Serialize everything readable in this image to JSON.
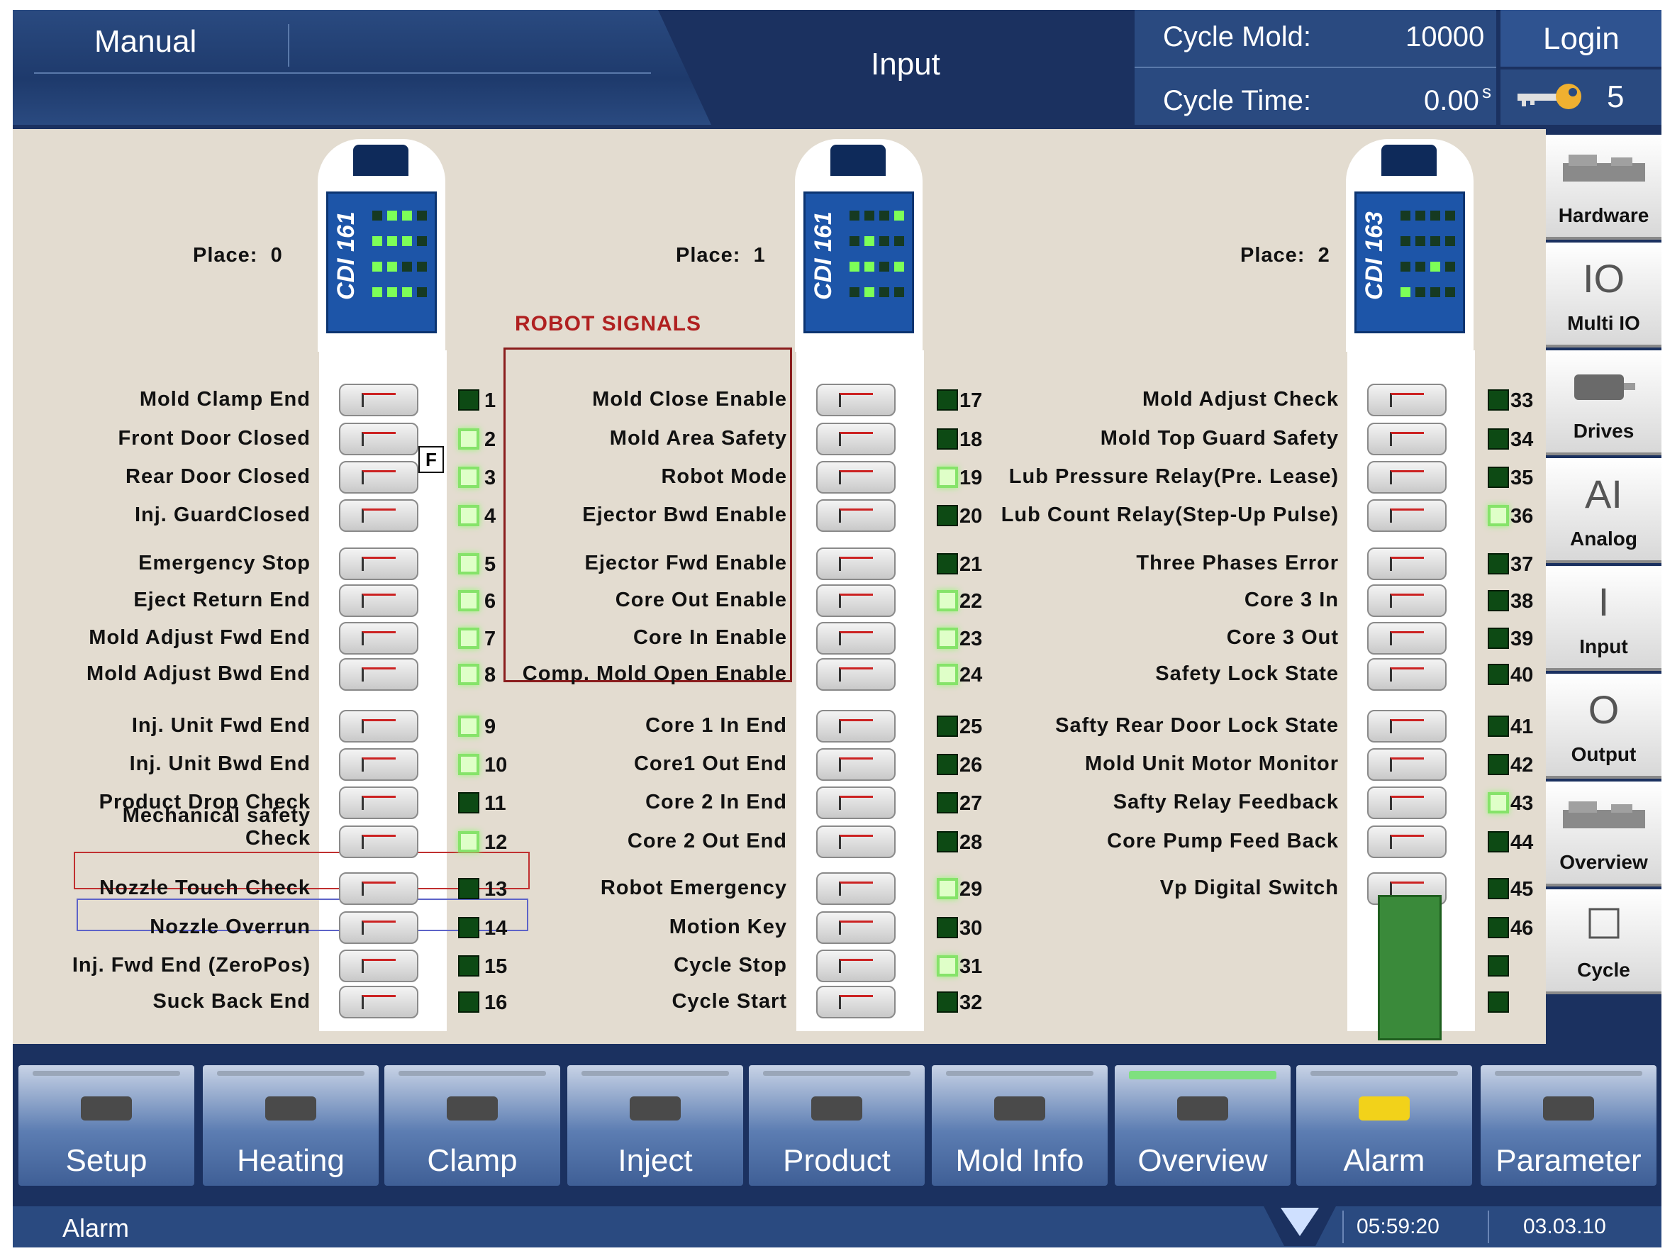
{
  "header": {
    "mode": "Manual",
    "screen_title": "Input",
    "cycle_mold_label": "Cycle Mold:",
    "cycle_mold_value": "10000",
    "cycle_time_label": "Cycle Time:",
    "cycle_time_value": "0.00",
    "cycle_time_unit": "s",
    "login_label": "Login",
    "user_level": "5"
  },
  "side_nav": [
    {
      "label": "Hardware",
      "icon": "machine-icon"
    },
    {
      "label": "Multi IO",
      "icon": "io-icon",
      "glyph": "IO"
    },
    {
      "label": "Drives",
      "icon": "drive-motor-icon"
    },
    {
      "label": "Analog",
      "icon": "analog-icon",
      "glyph": "AI"
    },
    {
      "label": "Input",
      "icon": "input-icon",
      "glyph": "I"
    },
    {
      "label": "Output",
      "icon": "output-icon",
      "glyph": "O"
    },
    {
      "label": "Overview",
      "icon": "machine-icon"
    },
    {
      "label": "Cycle",
      "icon": "cycle-icon"
    }
  ],
  "modules": [
    {
      "place_label": "Place:",
      "place_value": "0",
      "card": "CDI 161"
    },
    {
      "place_label": "Place:",
      "place_value": "1",
      "card": "CDI 161"
    },
    {
      "place_label": "Place:",
      "place_value": "2",
      "card": "CDI 163"
    }
  ],
  "robot_signals_title": "ROBOT SIGNALS",
  "force_marker": "F",
  "inputs_col0": [
    {
      "label": "Mold Clamp End",
      "num": "1",
      "on": false
    },
    {
      "label": "Front Door Closed",
      "num": "2",
      "on": true
    },
    {
      "label": "Rear Door Closed",
      "num": "3",
      "on": true
    },
    {
      "label": "Inj. GuardClosed",
      "num": "4",
      "on": true
    },
    {
      "label": "Emergency Stop",
      "num": "5",
      "on": true
    },
    {
      "label": "Eject Return End",
      "num": "6",
      "on": true
    },
    {
      "label": "Mold Adjust Fwd End",
      "num": "7",
      "on": true
    },
    {
      "label": "Mold Adjust Bwd End",
      "num": "8",
      "on": true
    },
    {
      "label": "Inj. Unit Fwd End",
      "num": "9",
      "on": true
    },
    {
      "label": "Inj. Unit Bwd End",
      "num": "10",
      "on": true
    },
    {
      "label": "Product Drop Check",
      "num": "11",
      "on": false
    },
    {
      "label": "Mechanical safety Check",
      "num": "12",
      "on": true
    },
    {
      "label": "Nozzle Touch Check",
      "num": "13",
      "on": false
    },
    {
      "label": "Nozzle Overrun",
      "num": "14",
      "on": false
    },
    {
      "label": "Inj. Fwd End (ZeroPos)",
      "num": "15",
      "on": false
    },
    {
      "label": "Suck Back End",
      "num": "16",
      "on": false
    }
  ],
  "inputs_col1": [
    {
      "label": "Mold Close Enable",
      "num": "17",
      "on": false
    },
    {
      "label": "Mold Area Safety",
      "num": "18",
      "on": false
    },
    {
      "label": "Robot Mode",
      "num": "19",
      "on": true
    },
    {
      "label": "Ejector Bwd Enable",
      "num": "20",
      "on": false
    },
    {
      "label": "Ejector Fwd Enable",
      "num": "21",
      "on": false
    },
    {
      "label": "Core Out Enable",
      "num": "22",
      "on": true
    },
    {
      "label": "Core In Enable",
      "num": "23",
      "on": true
    },
    {
      "label": "Comp. Mold Open Enable",
      "num": "24",
      "on": true
    },
    {
      "label": "Core 1 In End",
      "num": "25",
      "on": false
    },
    {
      "label": "Core1 Out End",
      "num": "26",
      "on": false
    },
    {
      "label": "Core 2 In End",
      "num": "27",
      "on": false
    },
    {
      "label": "Core 2 Out  End",
      "num": "28",
      "on": false
    },
    {
      "label": "Robot Emergency",
      "num": "29",
      "on": true
    },
    {
      "label": "Motion Key",
      "num": "30",
      "on": false
    },
    {
      "label": "Cycle Stop",
      "num": "31",
      "on": true
    },
    {
      "label": "Cycle Start",
      "num": "32",
      "on": false
    }
  ],
  "inputs_col2": [
    {
      "label": "Mold Adjust Check",
      "num": "33",
      "on": false
    },
    {
      "label": "Mold Top Guard Safety",
      "num": "34",
      "on": false
    },
    {
      "label": "Lub Pressure Relay(Pre. Lease)",
      "num": "35",
      "on": false
    },
    {
      "label": "Lub Count Relay(Step-Up Pulse)",
      "num": "36",
      "on": true
    },
    {
      "label": "Three Phases Error",
      "num": "37",
      "on": false
    },
    {
      "label": "Core 3 In",
      "num": "38",
      "on": false
    },
    {
      "label": "Core 3 Out",
      "num": "39",
      "on": false
    },
    {
      "label": "Safety Lock State",
      "num": "40",
      "on": false
    },
    {
      "label": "Safty Rear Door Lock State",
      "num": "41",
      "on": false
    },
    {
      "label": "Mold Unit Motor Monitor",
      "num": "42",
      "on": false
    },
    {
      "label": "Safty Relay Feedback",
      "num": "43",
      "on": true
    },
    {
      "label": "Core Pump Feed Back",
      "num": "44",
      "on": false
    },
    {
      "label": "Vp Digital Switch",
      "num": "45",
      "on": false
    },
    {
      "label": "",
      "num": "46",
      "on": false
    },
    {
      "label": "",
      "num": "",
      "on": false
    },
    {
      "label": "",
      "num": "",
      "on": false
    }
  ],
  "bottom_nav": [
    {
      "label": "Setup",
      "icon": "wrench-icon",
      "active": false
    },
    {
      "label": "Heating",
      "icon": "heater-thermometer-icon",
      "active": false
    },
    {
      "label": "Clamp",
      "icon": "clamp-icon",
      "active": false
    },
    {
      "label": "Inject",
      "icon": "screw-icon",
      "active": false
    },
    {
      "label": "Product",
      "icon": "product-icon",
      "active": false
    },
    {
      "label": "Mold Info",
      "icon": "floppy-disk-icon",
      "active": false
    },
    {
      "label": "Overview",
      "icon": "machine-icon",
      "active": true
    },
    {
      "label": "Alarm",
      "icon": "warning-icon",
      "active": false
    },
    {
      "label": "Parameter",
      "icon": "caliper-icon",
      "active": false
    }
  ],
  "status_bar": {
    "alarm_label": "Alarm",
    "time": "05:59:20",
    "date": "03.03.10"
  },
  "colors": {
    "background": "#e3dcd0",
    "header_blue": "#1b3160",
    "led_on": "#86e36a",
    "led_off": "#0d4a14",
    "robot_box": "#8a1d1d"
  }
}
